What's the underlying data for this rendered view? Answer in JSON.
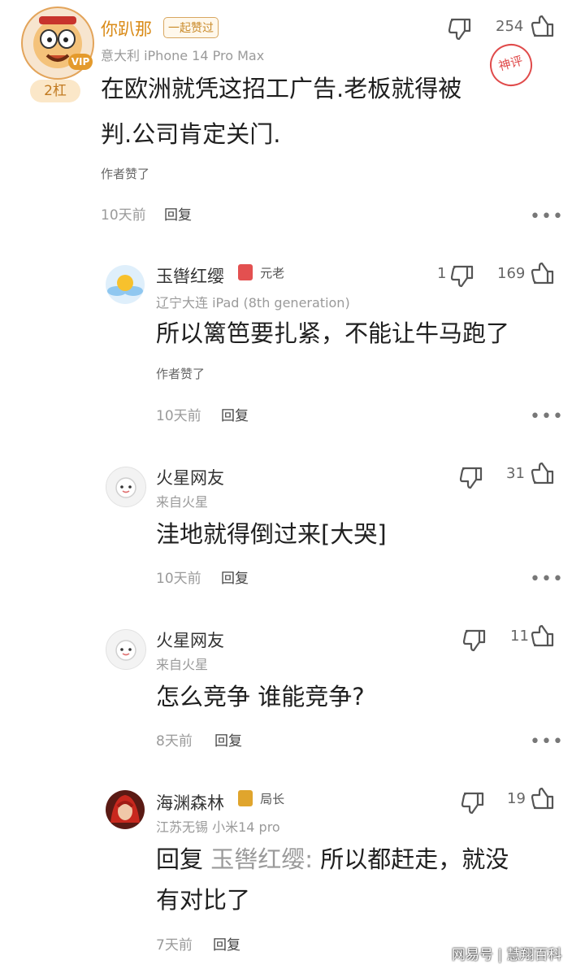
{
  "comment_main": {
    "username": "你趴那",
    "badge": "一起赞过",
    "location_device": "意大利  iPhone 14 Pro Max",
    "vip_label": "VIP",
    "level_label": "2杠",
    "hot_stamp": "神评",
    "text_line1": "在欧洲就凭这招工广告.老板就得被",
    "text_line2": "判.公司肯定关门.",
    "author_like": "作者赞了",
    "time": "10天前",
    "reply_label": "回复",
    "like_count": "254",
    "more": "•••"
  },
  "replies": [
    {
      "username": "玉辔红缨",
      "badge": "元老",
      "location_device": "辽宁大连  iPad (8th generation)",
      "text": "所以篱笆要扎紧，不能让牛马跑了",
      "author_like": "作者赞了",
      "time": "10天前",
      "reply_label": "回复",
      "dislike_count": "1",
      "like_count": "169",
      "more": "•••"
    },
    {
      "username": "火星网友",
      "location_device": "来自火星",
      "text": "洼地就得倒过来[大哭]",
      "time": "10天前",
      "reply_label": "回复",
      "like_count": "31",
      "more": "•••"
    },
    {
      "username": "火星网友",
      "location_device": "来自火星",
      "text": "怎么竞争 谁能竞争?",
      "time": "8天前",
      "reply_label": "回复",
      "like_count": "11",
      "more": "•••"
    },
    {
      "username": "海渊森林",
      "badge": "局长",
      "location_device": "江苏无锡  小米14 pro",
      "text_prefix": "回复 ",
      "text_quote": "玉辔红缨:",
      "text_rest_line1": " 所以都赶走，就没",
      "text_line2": "有对比了",
      "time": "7天前",
      "reply_label": "回复",
      "like_count": "19"
    }
  ],
  "watermark": "网易号 | 慧翔百科",
  "colors": {
    "main_username": "#d98a16",
    "hot_stamp": "#e04b4b",
    "badge_red": "#e35050",
    "badge_gold": "#e0a52d"
  }
}
